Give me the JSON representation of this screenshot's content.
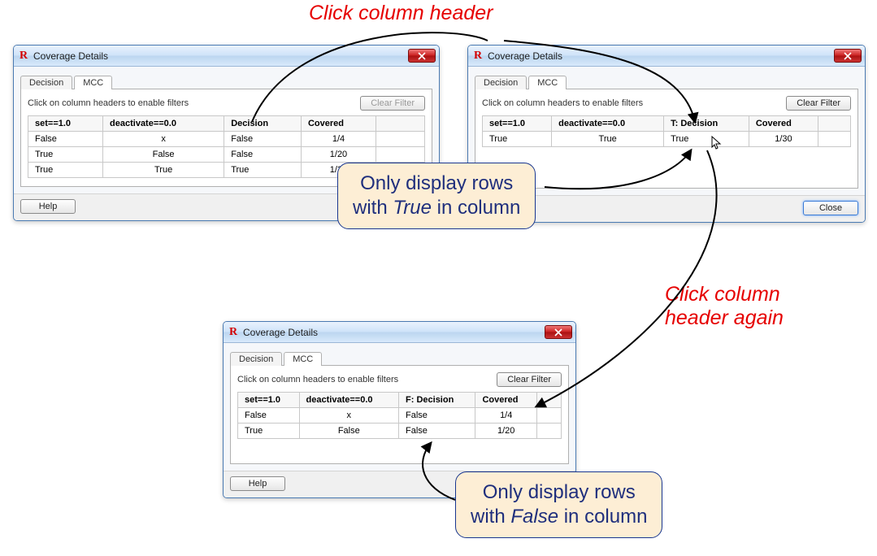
{
  "annotations": {
    "top": "Click column header",
    "right": "Click column\nheader again",
    "balloon1_a": "Only display rows",
    "balloon1_b_pre": "with ",
    "balloon1_b_em": "True",
    "balloon1_b_post": " in column",
    "balloon2_a": "Only display rows",
    "balloon2_b_pre": "with ",
    "balloon2_b_em": "False",
    "balloon2_b_post": " in column"
  },
  "dlg1": {
    "title": "Coverage Details",
    "tab_decision": "Decision",
    "tab_mcc": "MCC",
    "hint": "Click on column headers to enable filters",
    "clear": "Clear Filter",
    "help": "Help",
    "headers": {
      "c0": "set==1.0",
      "c1": "deactivate==0.0",
      "c2": "Decision",
      "c3": "Covered"
    },
    "rows": [
      {
        "c0": "False",
        "c1": "x",
        "c2": "False",
        "c3": "1/4"
      },
      {
        "c0": "True",
        "c1": "False",
        "c2": "False",
        "c3": "1/20"
      },
      {
        "c0": "True",
        "c1": "True",
        "c2": "True",
        "c3": "1/30"
      }
    ]
  },
  "dlg2": {
    "title": "Coverage Details",
    "tab_decision": "Decision",
    "tab_mcc": "MCC",
    "hint": "Click on column headers to enable filters",
    "clear": "Clear Filter",
    "close": "Close",
    "headers": {
      "c0": "set==1.0",
      "c1": "deactivate==0.0",
      "c2": "T: Decision",
      "c3": "Covered"
    },
    "rows": [
      {
        "c0": "True",
        "c1": "True",
        "c2": "True",
        "c3": "1/30"
      }
    ]
  },
  "dlg3": {
    "title": "Coverage Details",
    "tab_decision": "Decision",
    "tab_mcc": "MCC",
    "hint": "Click on column headers to enable filters",
    "clear": "Clear Filter",
    "help": "Help",
    "headers": {
      "c0": "set==1.0",
      "c1": "deactivate==0.0",
      "c2": "F: Decision",
      "c3": "Covered"
    },
    "rows": [
      {
        "c0": "False",
        "c1": "x",
        "c2": "False",
        "c3": "1/4"
      },
      {
        "c0": "True",
        "c1": "False",
        "c2": "False",
        "c3": "1/20"
      }
    ]
  }
}
